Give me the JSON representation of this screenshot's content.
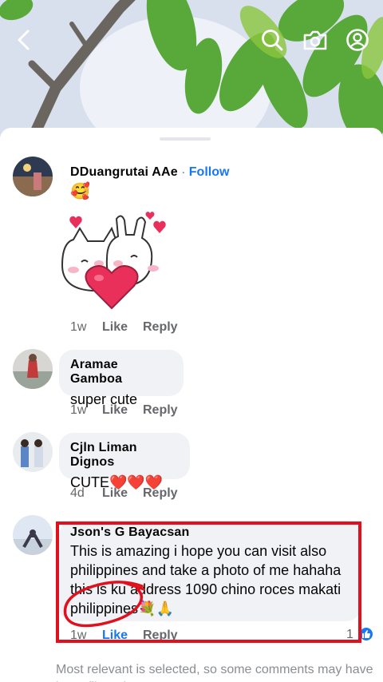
{
  "header": {
    "back_icon": "chevron-left-icon",
    "actions": [
      "search-icon",
      "camera-icon",
      "profile-icon"
    ]
  },
  "comments": [
    {
      "author": "DDuangrutai AAe",
      "follow_label": "Follow",
      "separator": "·",
      "text": "🥰",
      "sticker": "cat-bunny-heart-sticker",
      "time": "1w",
      "like_label": "Like",
      "reply_label": "Reply"
    },
    {
      "author": "Aramae Gamboa",
      "text": "super cute",
      "time": "1w",
      "like_label": "Like",
      "reply_label": "Reply"
    },
    {
      "author": "Cjln Liman Dignos",
      "text": "CUTE❤️❤️❤️",
      "time": "4d",
      "like_label": "Like",
      "reply_label": "Reply"
    },
    {
      "author": "Json's G Bayacsan",
      "text_lines": [
        "This is amazing i hope you can visit also",
        "philippines and take a photo of me hahaha",
        "this is ku address 1090 chino roces makati",
        "philippines💐🙏"
      ],
      "time": "1w",
      "like_label": "Like",
      "reply_label": "Reply",
      "like_count": "1"
    }
  ],
  "footer": {
    "note": "Most relevant is selected, so some comments may have been filtered out."
  },
  "colors": {
    "accent": "#1877f2",
    "annotation_red": "#e0101e",
    "bubble": "#f0f2f5"
  }
}
